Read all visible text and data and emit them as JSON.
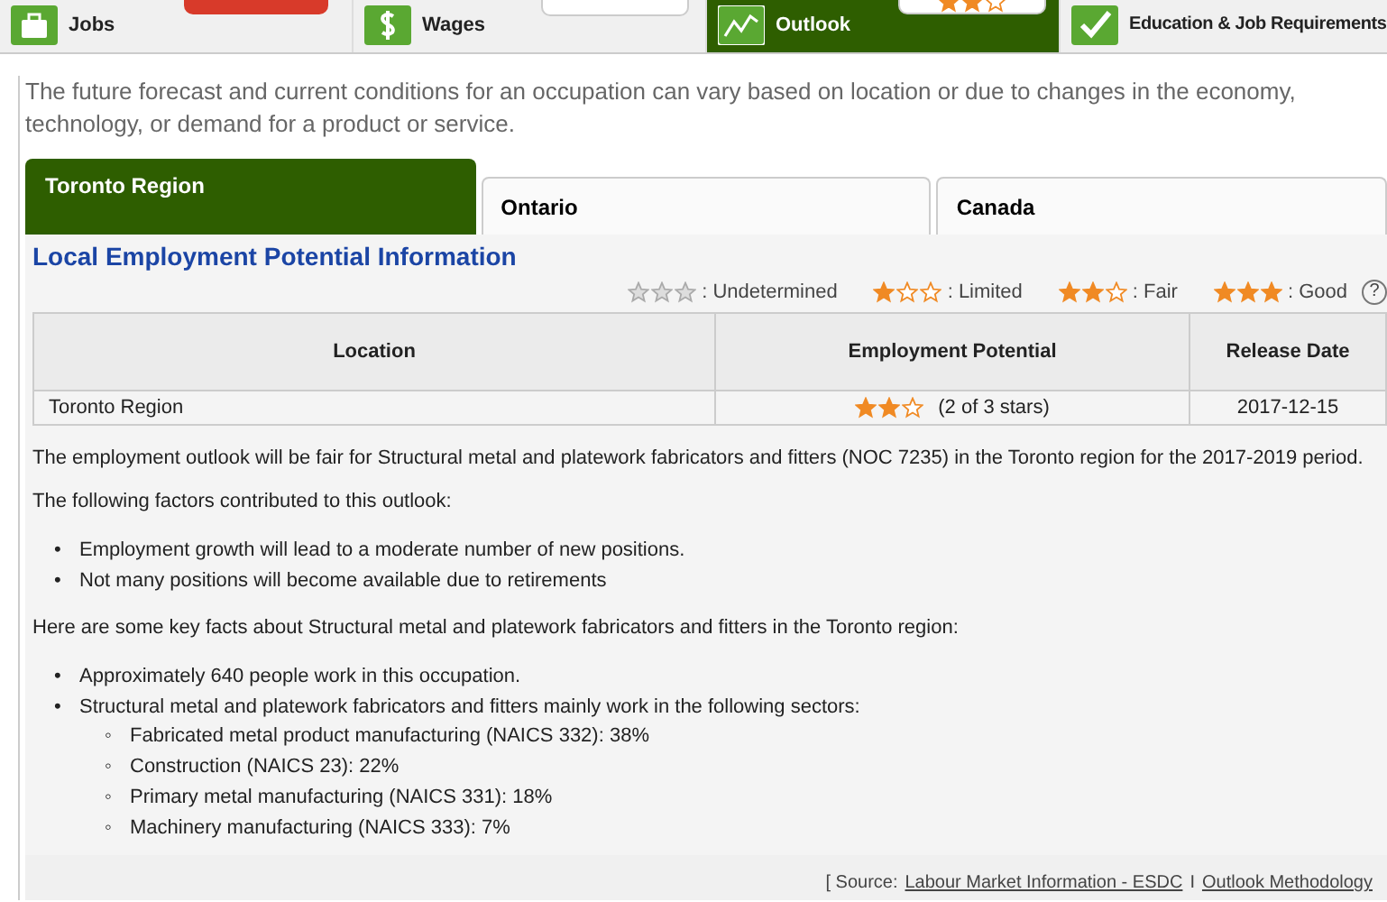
{
  "nav_tabs": [
    {
      "label": "Jobs",
      "selected": false
    },
    {
      "label": "Wages",
      "selected": false
    },
    {
      "label": "Outlook",
      "selected": true
    },
    {
      "label": "Education & Job Requirements",
      "selected": false
    }
  ],
  "intro": "The future forecast and current conditions for an occupation can vary based on location or due to changes in the economy, technology, or demand for a product or service.",
  "region_tabs": [
    {
      "label": "Toronto Region",
      "selected": true
    },
    {
      "label": "Ontario",
      "selected": false
    },
    {
      "label": "Canada",
      "selected": false
    }
  ],
  "heading": "Local Employment Potential Information",
  "legend": [
    {
      "label": ": Undetermined",
      "stars": 0,
      "kind": "undetermined"
    },
    {
      "label": ": Limited",
      "stars": 1,
      "kind": "rating"
    },
    {
      "label": ": Fair",
      "stars": 2,
      "kind": "rating"
    },
    {
      "label": ": Good",
      "stars": 3,
      "kind": "rating"
    }
  ],
  "help": "?",
  "table": {
    "columns": [
      "Location",
      "Employment Potential",
      "Release Date"
    ],
    "rows": [
      {
        "location": "Toronto Region",
        "stars": 2,
        "rating_text": "(2 of 3 stars)",
        "date": "2017-12-15"
      }
    ]
  },
  "outlook": "The employment outlook will be fair for Structural metal and platework fabricators and fitters (NOC 7235) in the Toronto region for the 2017-2019 period.",
  "factors_intro": "The following factors contributed to this outlook:",
  "factors": [
    {
      "marker": "•",
      "text": "Employment growth will lead to a moderate number of new positions."
    },
    {
      "marker": "•",
      "text": "Not many positions will become available due to retirements"
    }
  ],
  "facts_intro": "Here are some key facts about Structural metal and platework fabricators and fitters in the Toronto region:",
  "facts": [
    {
      "marker": "•",
      "text": "Approximately 640 people work in this occupation."
    },
    {
      "marker": "•",
      "text": "Structural metal and platework fabricators and fitters mainly work in the following sectors:",
      "children": [
        {
          "marker": "◦",
          "text": "Fabricated metal product manufacturing (NAICS 332): 38%"
        },
        {
          "marker": "◦",
          "text": "Construction (NAICS 23): 22%"
        },
        {
          "marker": "◦",
          "text": "Primary metal manufacturing (NAICS 331): 18%"
        },
        {
          "marker": "◦",
          "text": "Machinery manufacturing (NAICS 333): 7%"
        }
      ]
    }
  ],
  "source": {
    "prefix": "[ Source:",
    "links": [
      "Labour Market Information - ESDC",
      "Outlook Methodology"
    ],
    "separator": "I"
  }
}
